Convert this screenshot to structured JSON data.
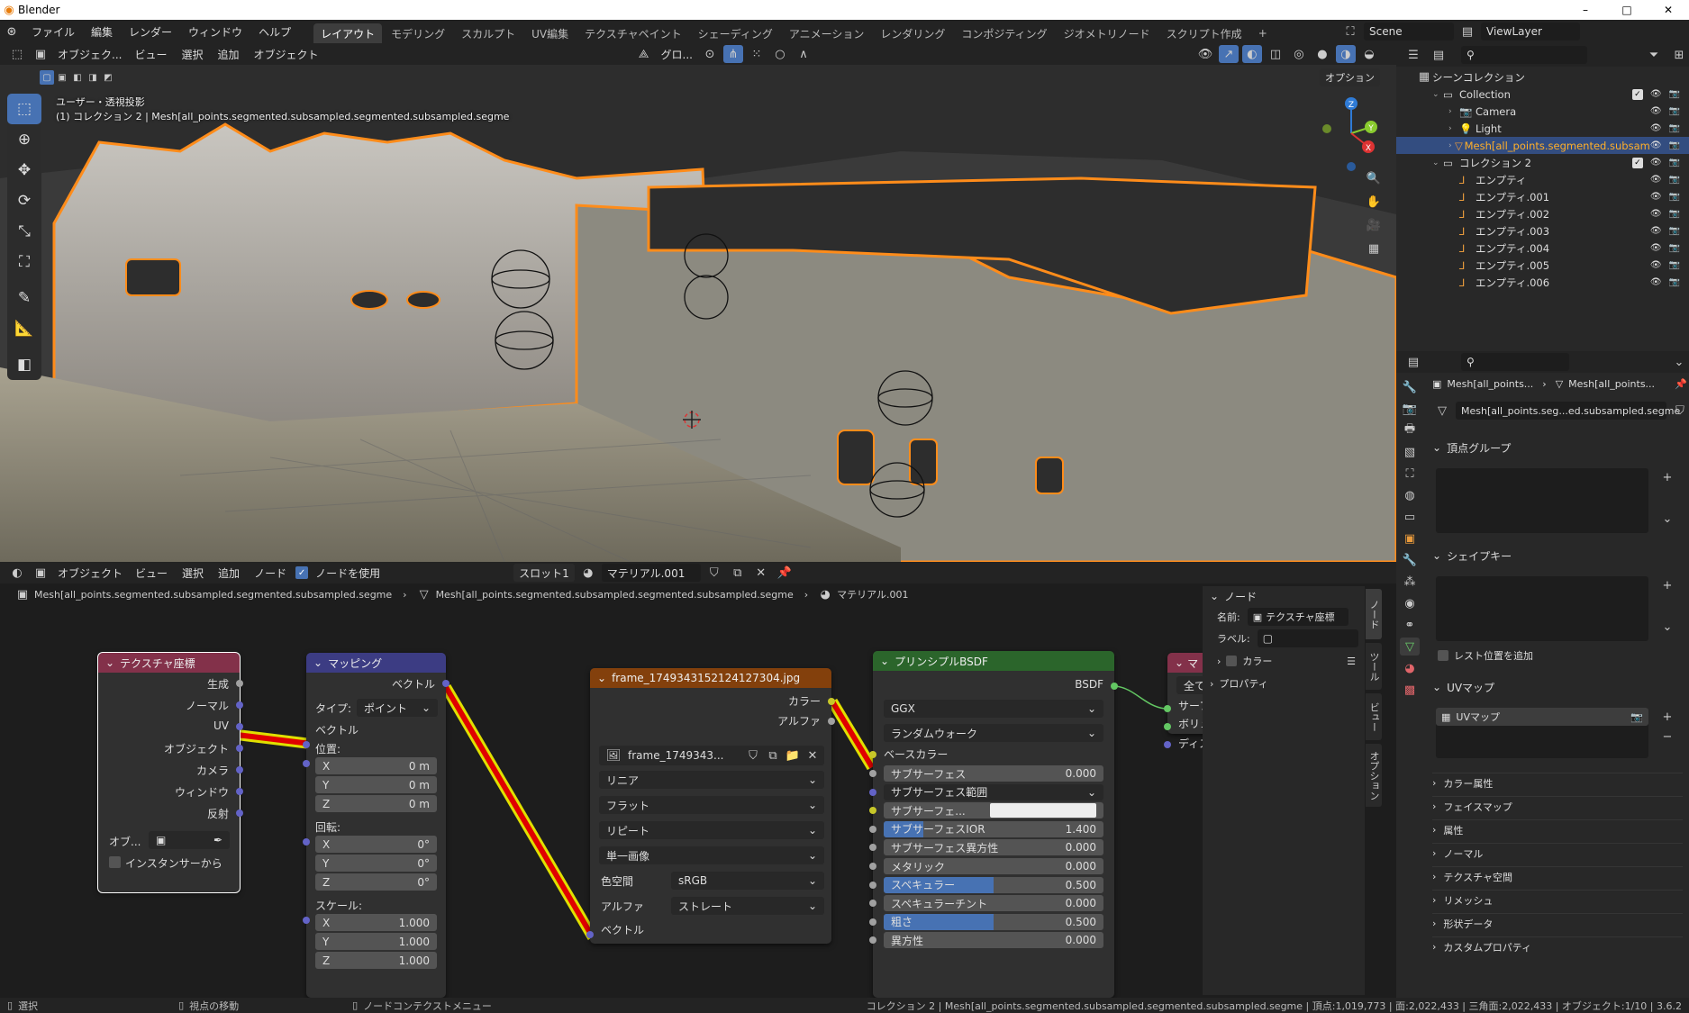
{
  "app": {
    "title": "Blender",
    "win_min": "–",
    "win_max": "□",
    "win_close": "✕"
  },
  "menu": {
    "items": [
      "ファイル",
      "編集",
      "レンダー",
      "ウィンドウ",
      "ヘルプ"
    ],
    "workspaces": [
      "レイアウト",
      "モデリング",
      "スカルプト",
      "UV編集",
      "テクスチャペイント",
      "シェーディング",
      "アニメーション",
      "レンダリング",
      "コンポジティング",
      "ジオメトリノード",
      "スクリプト作成"
    ],
    "plus": "+",
    "scene": "Scene",
    "viewlayer": "ViewLayer"
  },
  "viewport": {
    "mode": "オブジェク...",
    "menu": [
      "ビュー",
      "選択",
      "追加",
      "オブジェクト"
    ],
    "orientation": "グロ...",
    "options": "オプション",
    "info_line1": "ユーザー・透視投影",
    "info_line2": "(1) コレクション 2 | Mesh[all_points.segmented.subsampled.segmented.subsampled.segme",
    "gizmo": {
      "x": "X",
      "y": "Y",
      "z": "Z"
    }
  },
  "node_editor": {
    "mode": "オブジェクト",
    "menu": [
      "ビュー",
      "選択",
      "追加",
      "ノード"
    ],
    "use_nodes": "ノードを使用",
    "slot": "スロット1",
    "material": "マテリアル.001",
    "breadcrumb": [
      "Mesh[all_points.segmented.subsampled.segmented.subsampled.segme",
      "Mesh[all_points.segmented.subsampled.segmented.subsampled.segme",
      "マテリアル.001"
    ],
    "tex_coord": {
      "title": "テクスチャ座標",
      "outputs": [
        "生成",
        "ノーマル",
        "UV",
        "オブジェクト",
        "カメラ",
        "ウィンドウ",
        "反射"
      ],
      "object_label": "オブ...",
      "instancer": "インスタンサーから"
    },
    "mapping": {
      "title": "マッピング",
      "out": "ベクトル",
      "type_label": "タイプ:",
      "type_value": "ポイント",
      "in_vector": "ベクトル",
      "loc_label": "位置:",
      "rot_label": "回転:",
      "scale_label": "スケール:",
      "loc": [
        {
          "axis": "X",
          "val": "0 m"
        },
        {
          "axis": "Y",
          "val": "0 m"
        },
        {
          "axis": "Z",
          "val": "0 m"
        }
      ],
      "rot": [
        {
          "axis": "X",
          "val": "0°"
        },
        {
          "axis": "Y",
          "val": "0°"
        },
        {
          "axis": "Z",
          "val": "0°"
        }
      ],
      "scale": [
        {
          "axis": "X",
          "val": "1.000"
        },
        {
          "axis": "Y",
          "val": "1.000"
        },
        {
          "axis": "Z",
          "val": "1.000"
        }
      ]
    },
    "image": {
      "title": "frame_1749343152124127304.jpg",
      "out_color": "カラー",
      "out_alpha": "アルファ",
      "image_name": "frame_1749343...",
      "interp": "リニア",
      "proj": "フラット",
      "ext": "リピート",
      "source": "単一画像",
      "colorspace_label": "色空間",
      "colorspace": "sRGB",
      "alpha_label": "アルファ",
      "alpha": "ストレート",
      "in_vector": "ベクトル"
    },
    "bsdf": {
      "title": "プリンシプルBSDF",
      "out": "BSDF",
      "dist": "GGX",
      "sss_method": "ランダムウォーク",
      "base_color": "ベースカラー",
      "fields": [
        {
          "name": "サブサーフェス",
          "val": "0.000",
          "fill": 0
        },
        {
          "name": "サブサーフェス範囲",
          "val": "",
          "fill": 0,
          "dropdown": true
        },
        {
          "name": "サブサーフェ...",
          "val": "",
          "fill": 0,
          "color": true
        },
        {
          "name": "サブサーフェスIOR",
          "val": "1.400",
          "fill": 0.18
        },
        {
          "name": "サブサーフェス異方性",
          "val": "0.000",
          "fill": 0
        },
        {
          "name": "メタリック",
          "val": "0.000",
          "fill": 0
        },
        {
          "name": "スペキュラー",
          "val": "0.500",
          "fill": 0.5
        },
        {
          "name": "スペキュラーチント",
          "val": "0.000",
          "fill": 0
        },
        {
          "name": "粗さ",
          "val": "0.500",
          "fill": 0.5
        },
        {
          "name": "異方性",
          "val": "0.000",
          "fill": 0
        }
      ]
    },
    "output": {
      "title": "マ",
      "target": "全て",
      "inputs": [
        "サーフ",
        "ボリュ",
        "ディス"
      ]
    },
    "sidebar": {
      "header": "ノード",
      "name_label": "名前:",
      "name_value": "テクスチャ座標",
      "label_label": "ラベル:",
      "color": "カラー",
      "props": "プロパティ",
      "tabs": [
        "ノード",
        "ツール",
        "ビュー",
        "オプション"
      ]
    }
  },
  "outliner": {
    "scene_collection": "シーンコレクション",
    "rows": [
      {
        "name": "Collection",
        "indent": 1
      },
      {
        "name": "Camera",
        "indent": 2
      },
      {
        "name": "Light",
        "indent": 2
      },
      {
        "name": "Mesh[all_points.segmented.subsam",
        "indent": 2,
        "sel": true
      },
      {
        "name": "コレクション 2",
        "indent": 1
      },
      {
        "name": "エンプティ",
        "indent": 2
      },
      {
        "name": "エンプティ.001",
        "indent": 2
      },
      {
        "name": "エンプティ.002",
        "indent": 2
      },
      {
        "name": "エンプティ.003",
        "indent": 2
      },
      {
        "name": "エンプティ.004",
        "indent": 2
      },
      {
        "name": "エンプティ.005",
        "indent": 2
      },
      {
        "name": "エンプティ.006",
        "indent": 2
      }
    ]
  },
  "properties": {
    "bc1": "Mesh[all_points...",
    "bc2": "Mesh[all_points...",
    "mesh_name": "Mesh[all_points.seg...ed.subsampled.segme",
    "vertex_groups": "頂点グループ",
    "shape_keys": "シェイプキー",
    "relative": "レスト位置を追加",
    "uv_maps": "UVマップ",
    "uv_item": "UVマップ",
    "collapsed": [
      "カラー属性",
      "フェイスマップ",
      "属性",
      "ノーマル",
      "テクスチャ空間",
      "リメッシュ",
      "形状データ",
      "カスタムプロパティ"
    ]
  },
  "status": {
    "select": "選択",
    "move": "視点の移動",
    "ctx": "ノードコンテクストメニュー",
    "info": "コレクション 2 | Mesh[all_points.segmented.subsampled.segmented.subsampled.segme | 頂点:1,019,773 | 面:2,022,433 | 三角面:2,022,433 | オブジェクト:1/10 | 3.6.2"
  },
  "colors": {
    "accent": "#4772b3",
    "selection_outline": "#ff8c1a",
    "tex_header": "#83314a",
    "vec_header": "#3c3c83",
    "img_header": "#83400c",
    "shader_header": "#2b652b",
    "link_highlight": "#e0e000"
  }
}
